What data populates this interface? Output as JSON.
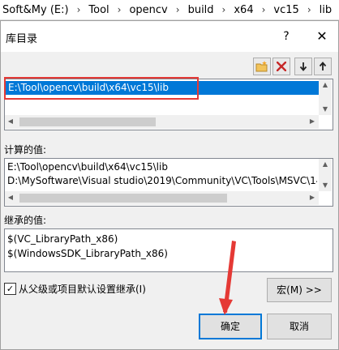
{
  "breadcrumb": [
    "Soft&My (E:)",
    "Tool",
    "opencv",
    "build",
    "x64",
    "vc15",
    "lib"
  ],
  "dialog": {
    "title": "库目录",
    "help": "?",
    "close": "✕"
  },
  "toolbar": {
    "new_icon": "new-folder-icon",
    "delete_icon": "delete-icon",
    "down_icon": "arrow-down-icon",
    "up_icon": "arrow-up-icon"
  },
  "directories": [
    "E:\\Tool\\opencv\\build\\x64\\vc15\\lib"
  ],
  "computed": {
    "label": "计算的值:",
    "lines": [
      "E:\\Tool\\opencv\\build\\x64\\vc15\\lib",
      "D:\\MySoftware\\Visual studio\\2019\\Community\\VC\\Tools\\MSVC\\14"
    ]
  },
  "inherited": {
    "label": "继承的值:",
    "lines": [
      "$(VC_LibraryPath_x86)",
      "$(WindowsSDK_LibraryPath_x86)"
    ]
  },
  "inherit_checkbox": {
    "checked": true,
    "mark": "✓",
    "label": "从父级或项目默认设置继承(I)"
  },
  "buttons": {
    "macro": "宏(M) >>",
    "ok": "确定",
    "cancel": "取消"
  },
  "colors": {
    "selection": "#0078d7",
    "highlight_box": "#e53935",
    "annotation_arrow": "#e53935"
  }
}
